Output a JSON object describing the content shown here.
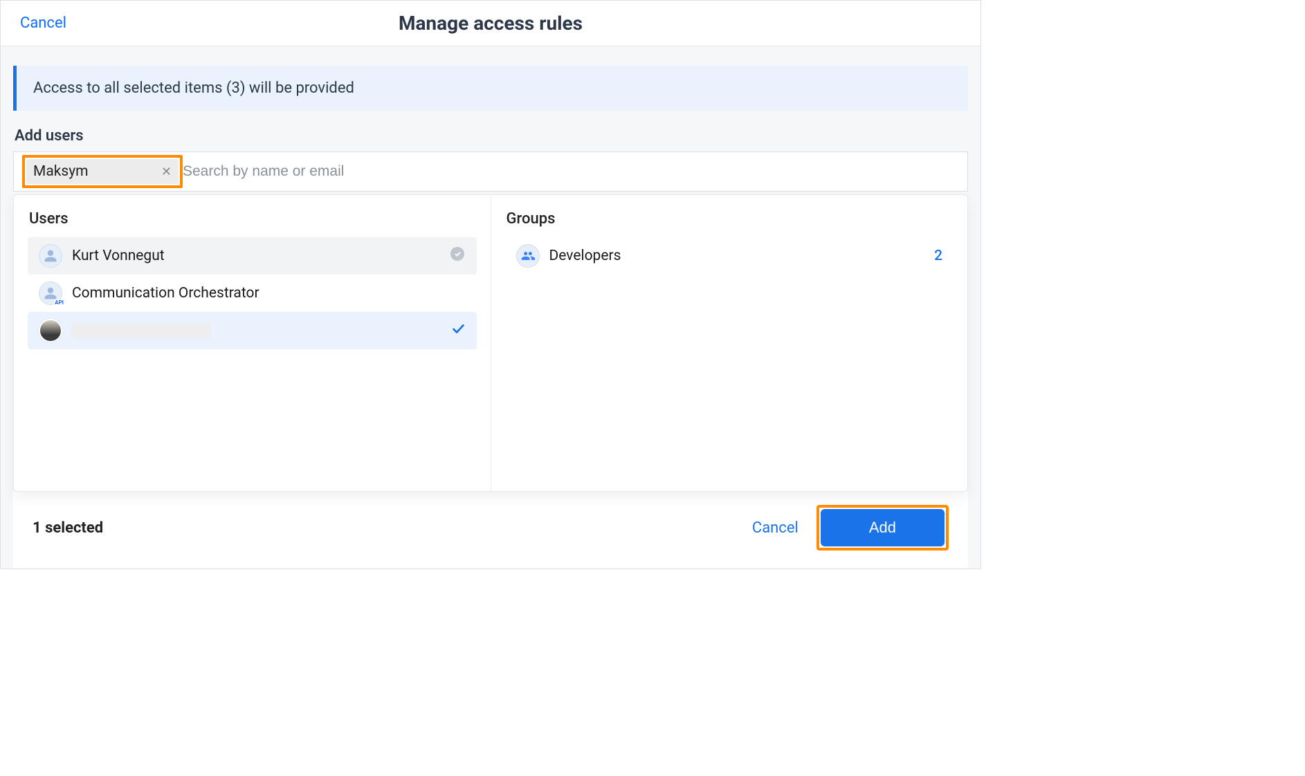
{
  "header": {
    "cancel": "Cancel",
    "title": "Manage access rules"
  },
  "info_banner": "Access to all selected items (3) will be provided",
  "section_label": "Add users",
  "search": {
    "chip_label": "Maksym",
    "placeholder": "Search by name or email"
  },
  "users": {
    "heading": "Users",
    "items": [
      {
        "name": "Kurt Vonnegut",
        "avatar": "silhouette",
        "state": "hl",
        "check": "grey"
      },
      {
        "name": "Communication Orchestrator",
        "avatar": "api",
        "state": "",
        "check": ""
      },
      {
        "name": "",
        "avatar": "photo",
        "state": "sel",
        "check": "blue"
      }
    ]
  },
  "groups": {
    "heading": "Groups",
    "items": [
      {
        "name": "Developers",
        "count": "2"
      }
    ]
  },
  "footer": {
    "selected": "1 selected",
    "cancel": "Cancel",
    "add": "Add"
  }
}
